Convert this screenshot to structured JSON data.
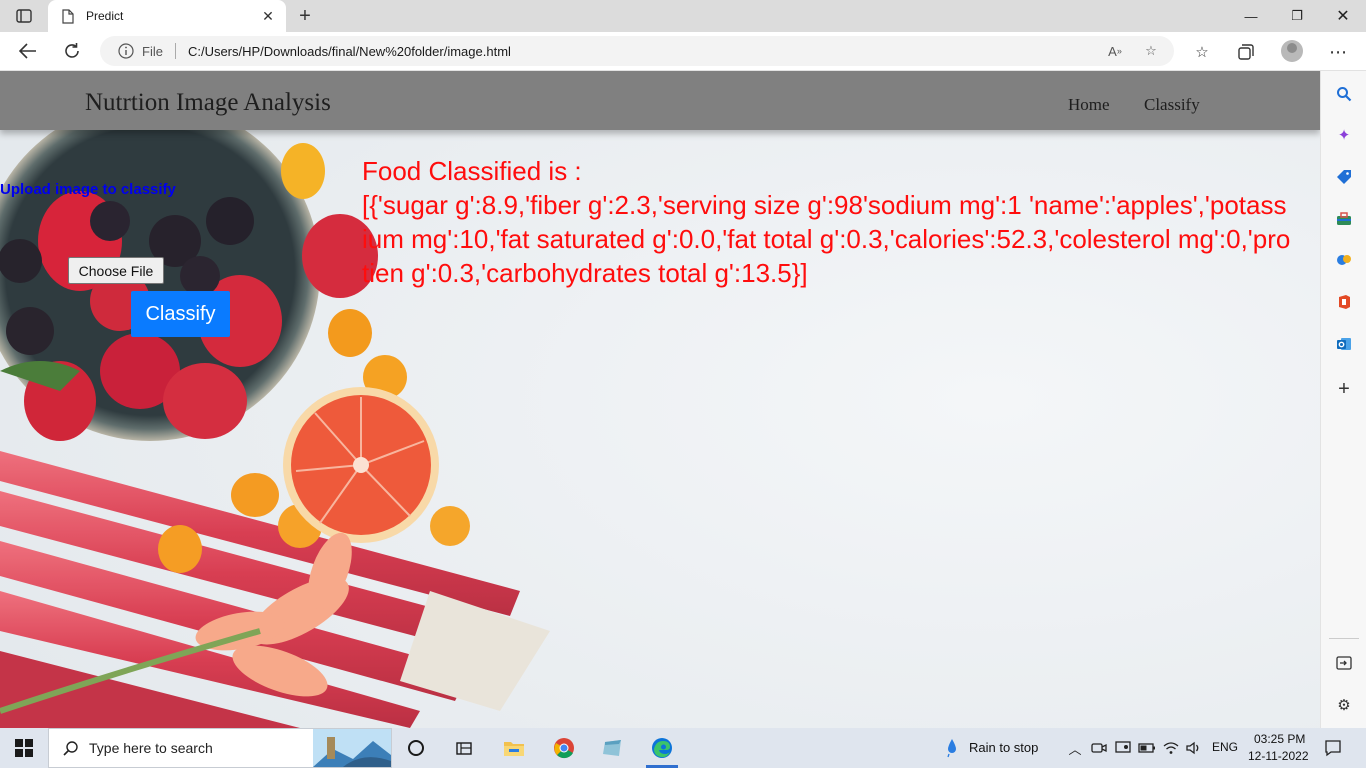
{
  "browser": {
    "tab_title": "Predict",
    "url_scheme_label": "File",
    "url_path": "C:/Users/HP/Downloads/final/New%20folder/image.html"
  },
  "site": {
    "brand": "Nutrtion Image Analysis",
    "nav": [
      "Home",
      "Classify"
    ]
  },
  "upload": {
    "label": "Upload image to classify",
    "choose_file": "Choose File",
    "classify_button": "Classify"
  },
  "result": {
    "heading": "Food Classified is :",
    "json": "[{'sugar g':8.9,'fiber g':2.3,'serving size g':98'sodium mg':1 'name':'apples','potassium mg':10,'fat saturated g':0.0,'fat total g':0.3,'calories':52.3,'colesterol mg':0,'protien g':0.3,'carbohydrates total g':13.5}]"
  },
  "taskbar": {
    "search_placeholder": "Type here to search",
    "weather": "Rain to stop",
    "language": "ENG",
    "time": "03:25 PM",
    "date": "12-11-2022"
  },
  "colors": {
    "navbar": "#808080",
    "result_text": "#ff0d0d",
    "link": "#0000ee",
    "button": "#0a7bff"
  }
}
